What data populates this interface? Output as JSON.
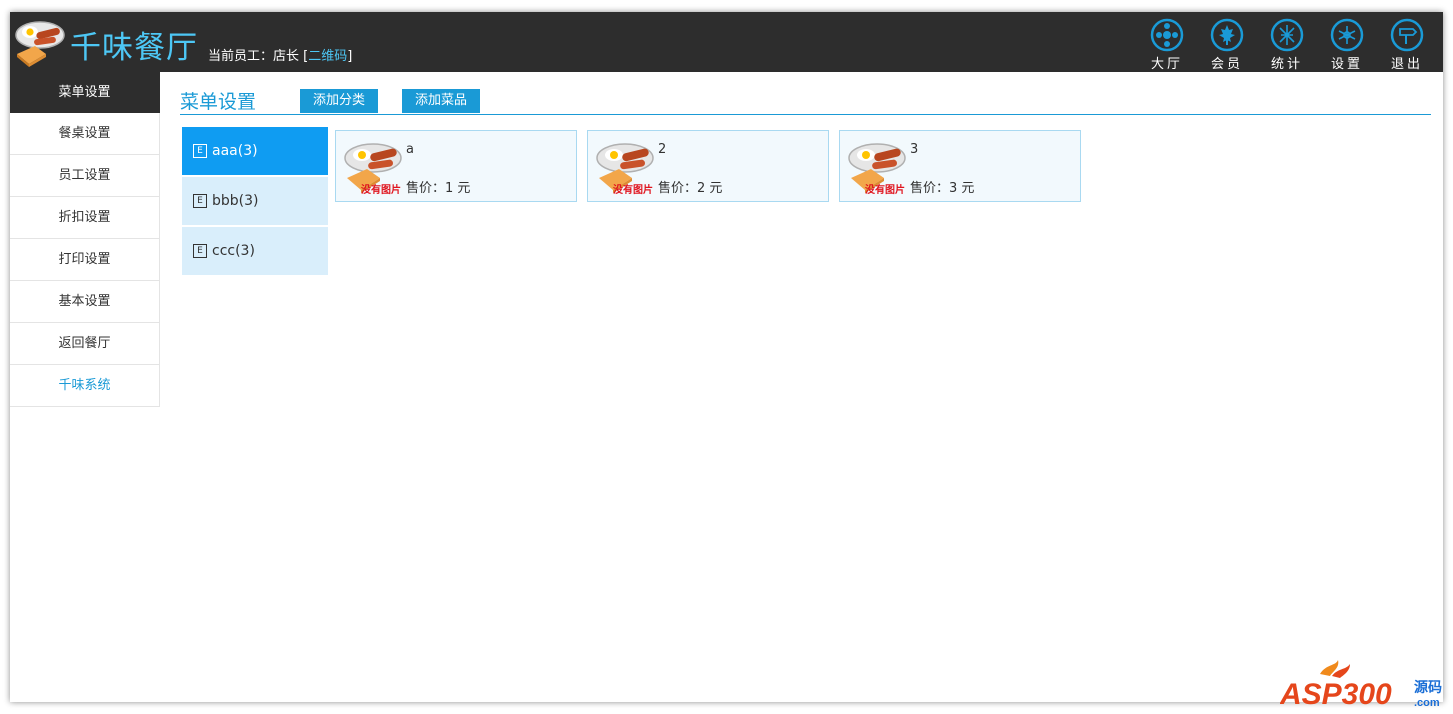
{
  "header": {
    "app_title": "千味餐厅",
    "staff_label": "当前员工：店长",
    "qr_open": "[",
    "qr_link": "二维码",
    "qr_close": "]",
    "nav": [
      {
        "label": "大厅",
        "icon": "hall-icon"
      },
      {
        "label": "会员",
        "icon": "member-icon"
      },
      {
        "label": "统计",
        "icon": "stats-icon"
      },
      {
        "label": "设置",
        "icon": "settings-icon"
      },
      {
        "label": "退出",
        "icon": "exit-icon"
      }
    ]
  },
  "sidebar": {
    "items": [
      {
        "label": "菜单设置"
      },
      {
        "label": "餐桌设置"
      },
      {
        "label": "员工设置"
      },
      {
        "label": "折扣设置"
      },
      {
        "label": "打印设置"
      },
      {
        "label": "基本设置"
      },
      {
        "label": "返回餐厅"
      },
      {
        "label": "千味系统"
      }
    ]
  },
  "main": {
    "title": "菜单设置",
    "add_category": "添加分类",
    "add_dish": "添加菜品",
    "categories": [
      {
        "badge": "E",
        "label": "aaa(3)"
      },
      {
        "badge": "E",
        "label": "bbb(3)"
      },
      {
        "badge": "E",
        "label": "ccc(3)"
      }
    ],
    "dishes": [
      {
        "name": "a",
        "price": "售价：1 元",
        "img_text": "没有图片"
      },
      {
        "name": "2",
        "price": "售价：2 元",
        "img_text": "没有图片"
      },
      {
        "name": "3",
        "price": "售价：3 元",
        "img_text": "没有图片"
      }
    ]
  },
  "watermark": {
    "brand": "ASP300",
    "suffix": "源码",
    "domain": ".com"
  },
  "colors": {
    "accent": "#1a9ad6",
    "header_bg": "#2d2d2d",
    "active_category": "#0f9cf2",
    "category_bg": "#d9eefb"
  }
}
